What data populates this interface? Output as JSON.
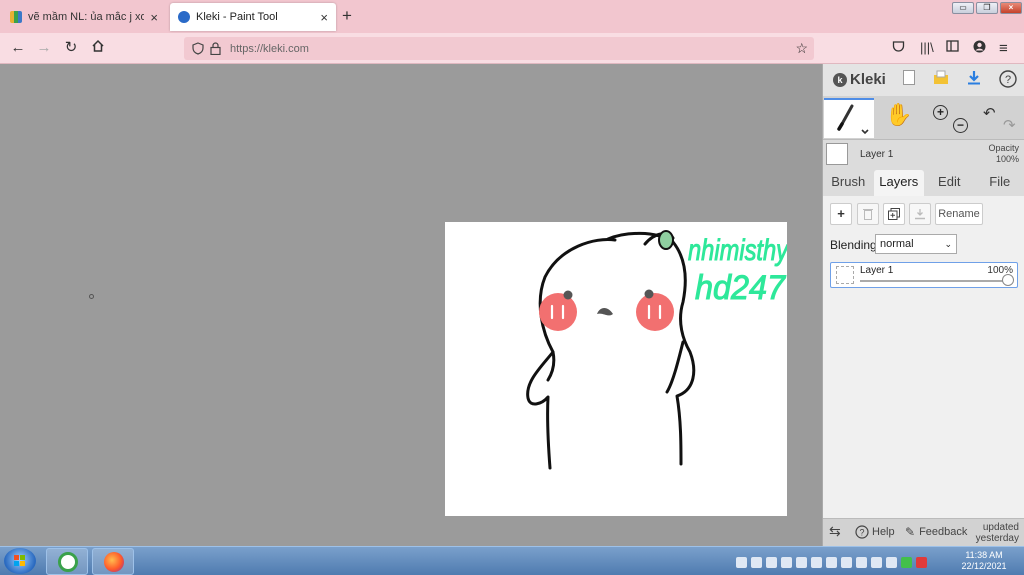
{
  "browser": {
    "tabs": [
      {
        "label": "vẽ mầm NL: ủa mắc j xoá ctrl cũ",
        "close": "×"
      },
      {
        "label": "Kleki - Paint Tool",
        "close": "×"
      }
    ],
    "new_tab": "+",
    "url": "https://kleki.com",
    "window_controls": {
      "minimize": "▭",
      "maximize": "❐",
      "close": "×"
    }
  },
  "kleki": {
    "logo": "Kleki",
    "layer_name": "Layer 1",
    "opacity_label": "Opacity",
    "opacity_value": "100%",
    "tabs": [
      "Brush",
      "Layers",
      "Edit",
      "File"
    ],
    "active_tab": "Layers",
    "layer_buttons": {
      "add": "+",
      "rename": "Rename"
    },
    "blending_label": "Blending",
    "blending_value": "normal",
    "layer_list": [
      {
        "name": "Layer 1",
        "opacity": "100%",
        "opacity_fraction": 1.0
      }
    ],
    "bottom": {
      "help": "Help",
      "feedback": "Feedback",
      "updated": "updated yesterday"
    }
  },
  "canvas_text": {
    "line1": "nhimisthy",
    "line2": "hd247"
  },
  "colors": {
    "accent": "#4f8de6",
    "canvas_text": "#2ee89a",
    "cheeks": "#f27070"
  },
  "taskbar": {
    "time": "11:38 AM",
    "date": "22/12/2021"
  }
}
